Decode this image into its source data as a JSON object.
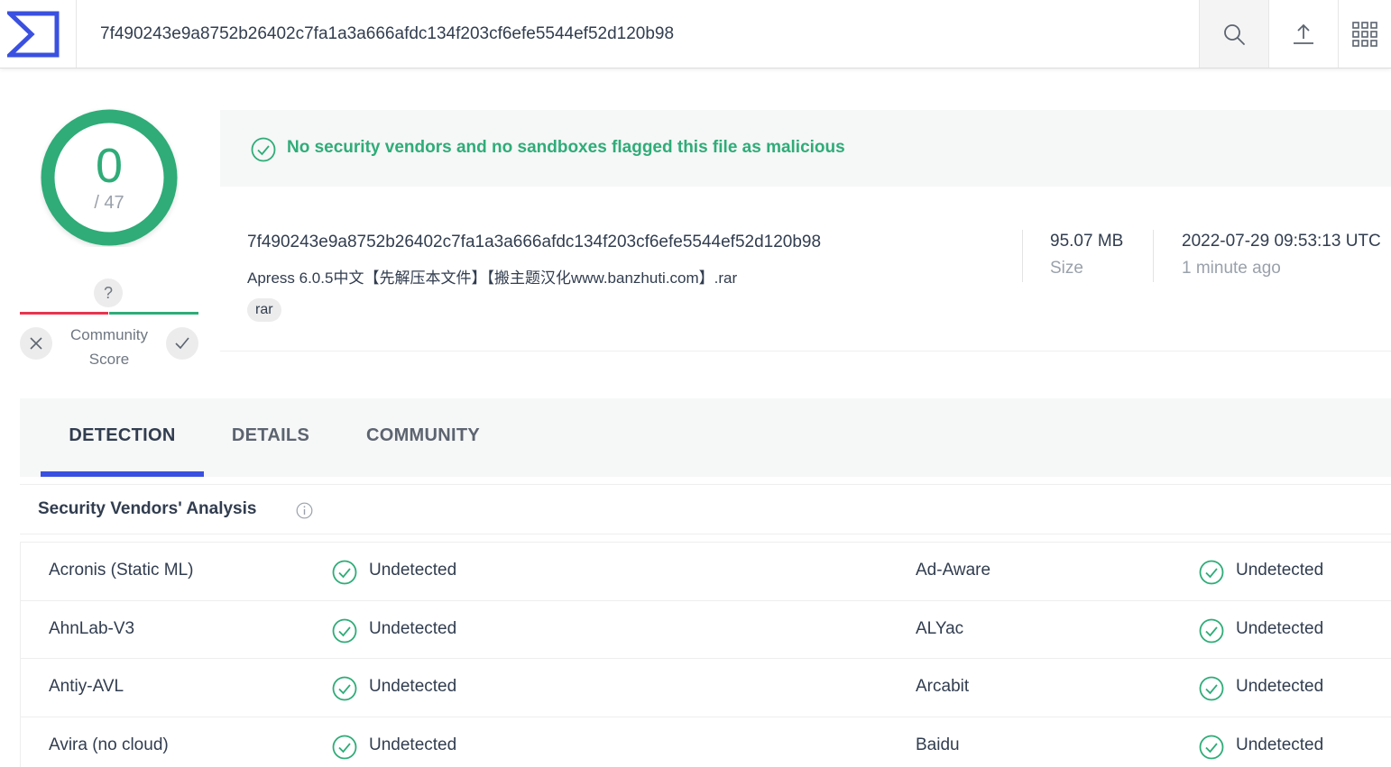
{
  "header": {
    "search_value": "7f490243e9a8752b26402c7fa1a3a666afdc134f203cf6efe5544ef52d120b98"
  },
  "score": {
    "detections": "0",
    "total": "/ 47",
    "fraction": 0
  },
  "community": {
    "label_line1": "Community",
    "label_line2": "Score",
    "question": "?"
  },
  "banner": {
    "message": "No security vendors and no sandboxes flagged this file as malicious"
  },
  "file": {
    "hash": "7f490243e9a8752b26402c7fa1a3a666afdc134f203cf6efe5544ef52d120b98",
    "name": "Apress 6.0.5中文【先解压本文件】【搬主题汉化www.banzhuti.com】.rar",
    "tag": "rar",
    "size_value": "95.07 MB",
    "size_label": "Size",
    "date_value": "2022-07-29 09:53:13 UTC",
    "date_label": "1 minute ago"
  },
  "tabs": [
    {
      "label": "DETECTION"
    },
    {
      "label": "DETAILS"
    },
    {
      "label": "COMMUNITY"
    }
  ],
  "analysis": {
    "title": "Security Vendors' Analysis",
    "rows": [
      {
        "left_vendor": "Acronis (Static ML)",
        "left_result": "Undetected",
        "right_vendor": "Ad-Aware",
        "right_result": "Undetected"
      },
      {
        "left_vendor": "AhnLab-V3",
        "left_result": "Undetected",
        "right_vendor": "ALYac",
        "right_result": "Undetected"
      },
      {
        "left_vendor": "Antiy-AVL",
        "left_result": "Undetected",
        "right_vendor": "Arcabit",
        "right_result": "Undetected"
      },
      {
        "left_vendor": "Avira (no cloud)",
        "left_result": "Undetected",
        "right_vendor": "Baidu",
        "right_result": "Undetected"
      }
    ]
  },
  "colors": {
    "accent": "#3a50e0",
    "clean": "#2fac78",
    "malicious": "#e8344e"
  }
}
